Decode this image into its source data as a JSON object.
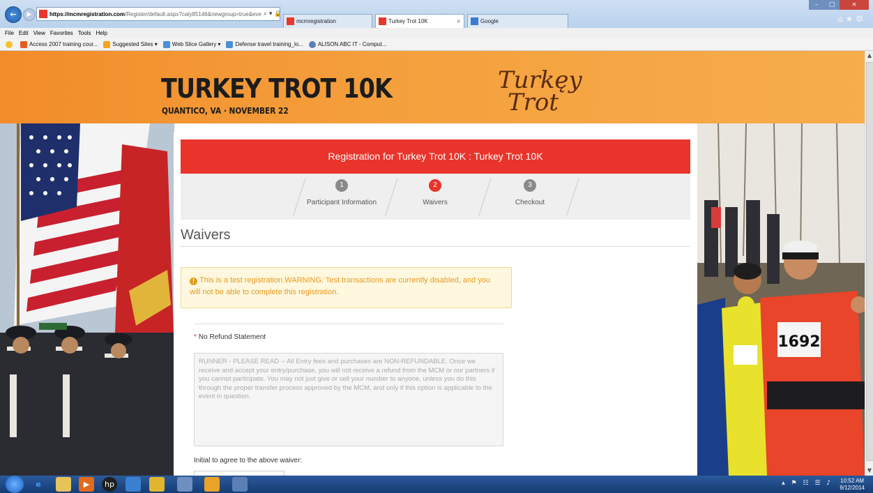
{
  "browser": {
    "url_host": "https://mcmregistration.com",
    "url_path": "/Register/default.aspx?caty85146&newgroup=true&eve",
    "address_tools": "⌕ ▾ 🔒 ↻",
    "tabs": [
      {
        "label": "mcmregistration",
        "active": false
      },
      {
        "label": "Turkey Trot 10K",
        "active": true
      },
      {
        "label": "Google",
        "active": false
      }
    ],
    "menu": [
      "File",
      "Edit",
      "View",
      "Favorites",
      "Tools",
      "Help"
    ],
    "favorites": [
      "Access 2007 training cour...",
      "Suggested Sites ▾",
      "Web Slice Gallery ▾",
      "Defense travel training_lo...",
      "ALISON ABC IT - Comput..."
    ],
    "right_icons": "⌂★⚙"
  },
  "banner": {
    "title": "TURKEY TROT 10K",
    "subtitle": "QUANTICO, VA · NOVEMBER 22",
    "logo_line1": "Turkęy",
    "logo_line2": "Trot"
  },
  "registration": {
    "header": "Registration for Turkey Trot 10K : Turkey Trot 10K",
    "steps": [
      {
        "num": "1",
        "label": "Participant Information"
      },
      {
        "num": "2",
        "label": "Waivers"
      },
      {
        "num": "3",
        "label": "Checkout"
      }
    ],
    "active_step": 2
  },
  "waivers": {
    "heading": "Waivers",
    "alert_icon": "!",
    "alert_text": "This is a test registration.WARNING: Test transactions are currently disabled, and you will not be able to complete this registration.",
    "required_mark": "*",
    "field_label": "No Refund Statement",
    "statement": "RUNNER - PLEASE READ  --  All Entry fees and purchases are NON-REFUNDABLE. Once we receive and accept your entry/purchase, you will not receive a refund from the MCM or our partners if you cannot participate. You may not just give or sell your number to anyone, unless you do this through the proper transfer process approved by the MCM, and only if this option is applicable to the event in question.",
    "initial_label": "Initial to agree to the above waiver:",
    "initial_value": ""
  },
  "taskbar": {
    "time": "10:52 AM",
    "date": "9/12/2014",
    "tray": "▴ ⚑ ☷ ☰ ♪"
  },
  "colors": {
    "accent_red": "#e9342b",
    "banner_orange": "#f28c2a",
    "warning_text": "#e69a20"
  }
}
